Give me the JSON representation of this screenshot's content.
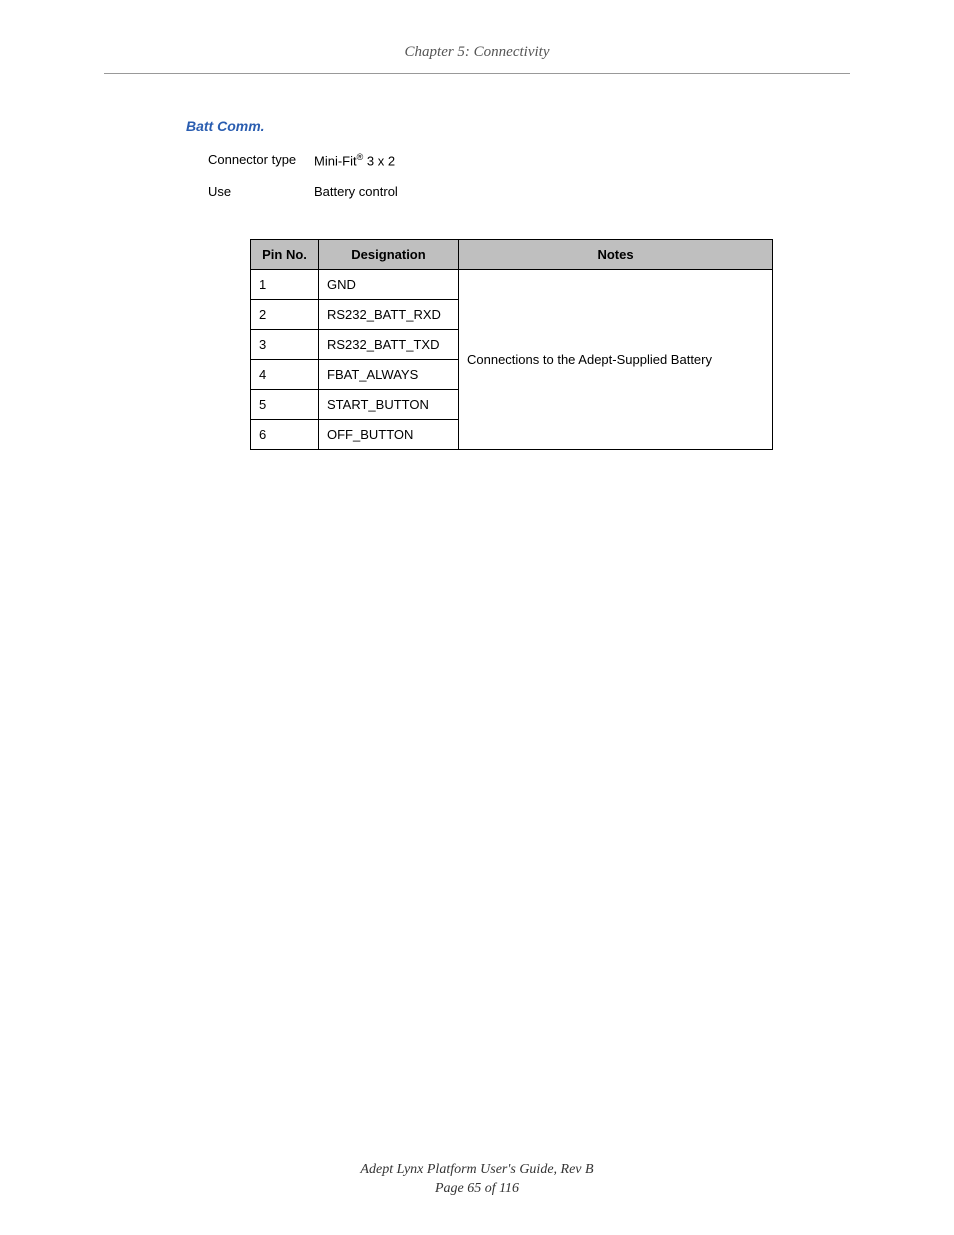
{
  "header": {
    "chapter": "Chapter 5: Connectivity"
  },
  "section": {
    "title": "Batt Comm.",
    "info": [
      {
        "label": "Connector type",
        "value_prefix": "Mini-Fit",
        "value_sup": "®",
        "value_suffix": " 3 x 2"
      },
      {
        "label": "Use",
        "value_prefix": "Battery control",
        "value_sup": "",
        "value_suffix": ""
      }
    ]
  },
  "table": {
    "headers": {
      "pin": "Pin No.",
      "designation": "Designation",
      "notes": "Notes"
    },
    "rows": [
      {
        "pin": "1",
        "designation": "GND"
      },
      {
        "pin": "2",
        "designation": "RS232_BATT_RXD"
      },
      {
        "pin": "3",
        "designation": "RS232_BATT_TXD"
      },
      {
        "pin": "4",
        "designation": "FBAT_ALWAYS"
      },
      {
        "pin": "5",
        "designation": "START_BUTTON"
      },
      {
        "pin": "6",
        "designation": "OFF_BUTTON"
      }
    ],
    "notes_merged": "Connections to the Adept-Supplied Battery"
  },
  "footer": {
    "doc_title": "Adept Lynx Platform User's Guide, Rev B",
    "page_line": "Page 65 of 116"
  }
}
